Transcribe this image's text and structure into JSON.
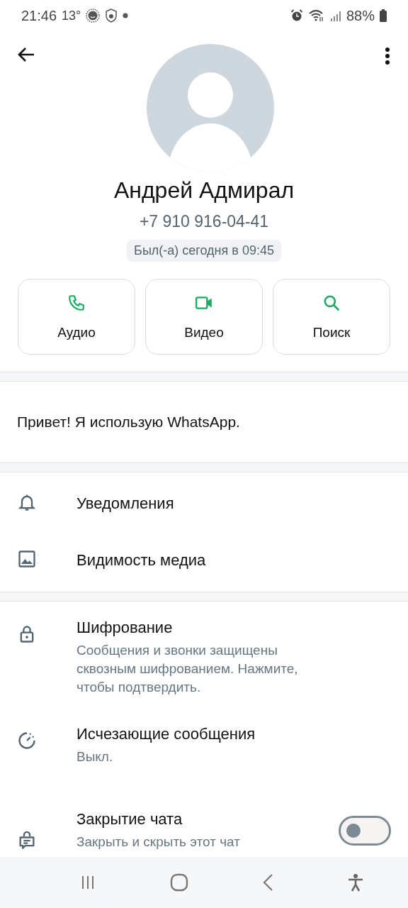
{
  "status_bar": {
    "time": "21:46",
    "temperature": "13°",
    "battery": "88%"
  },
  "contact": {
    "name": "Андрей Адмирал",
    "phone": "+7 910 916-04-41",
    "last_seen": "Был(-а) сегодня в 09:45"
  },
  "actions": [
    {
      "kind": "audio",
      "label": "Аудио"
    },
    {
      "kind": "video",
      "label": "Видео"
    },
    {
      "kind": "search",
      "label": "Поиск"
    }
  ],
  "about": "Привет! Я использую WhatsApp.",
  "settings": [
    {
      "kind": "notifications",
      "title": "Уведомления"
    },
    {
      "kind": "media",
      "title": "Видимость медиа"
    }
  ],
  "privacy": [
    {
      "kind": "encryption",
      "title": "Шифрование",
      "subtitle": "Сообщения и звонки защищены сквозным шифрованием. Нажмите, чтобы подтвердить."
    },
    {
      "kind": "timer",
      "title": "Исчезающие сообщения",
      "subtitle": "Выкл."
    },
    {
      "kind": "lock",
      "title": "Закрытие чата",
      "subtitle": "Закрыть и скрыть этот чат",
      "on": false
    }
  ]
}
